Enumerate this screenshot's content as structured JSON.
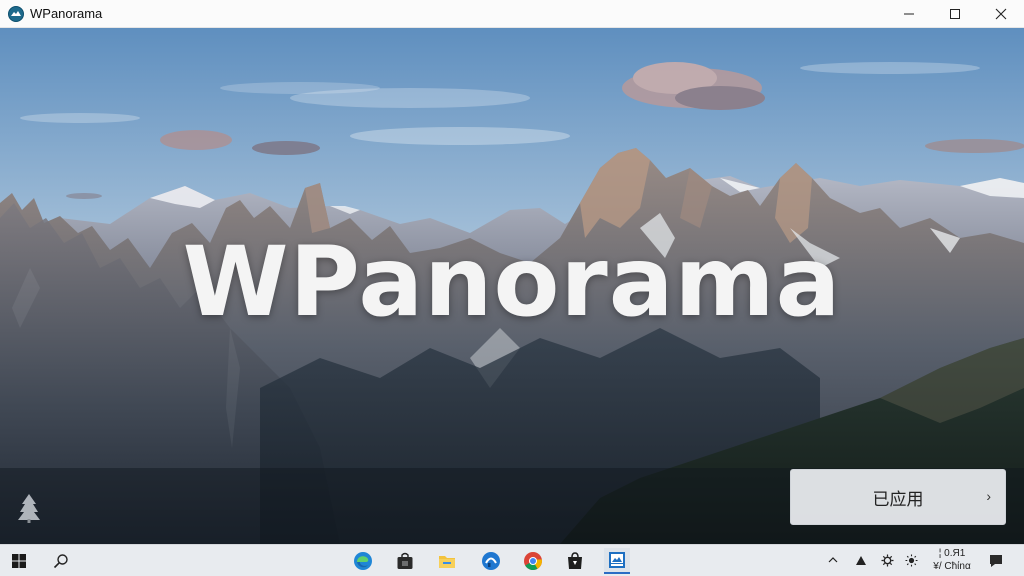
{
  "window": {
    "title": "WPanorama"
  },
  "hero": {
    "title": "WPanorama"
  },
  "apply_button": {
    "label": "已应用",
    "chevron": "›"
  },
  "taskbar": {
    "clock_line1": "¦ 0.Я1",
    "clock_line2": "¥/ Cħίnα"
  },
  "icons": {
    "app": "wpanorama-app-icon",
    "minimize": "minimize-icon",
    "maximize": "maximize-icon",
    "close": "close-icon",
    "start": "windows-start-icon",
    "search": "search-icon",
    "edge": "edge-browser-icon",
    "store": "store-bag-icon",
    "explorer": "file-explorer-icon",
    "blue_app": "blue-circle-app-icon",
    "chrome": "chrome-icon",
    "black_app": "dark-bag-app-icon",
    "wpanorama": "wpanorama-taskbar-icon"
  },
  "colors": {
    "accent": "#2b6cc4",
    "taskbar": "#e8ebef"
  }
}
